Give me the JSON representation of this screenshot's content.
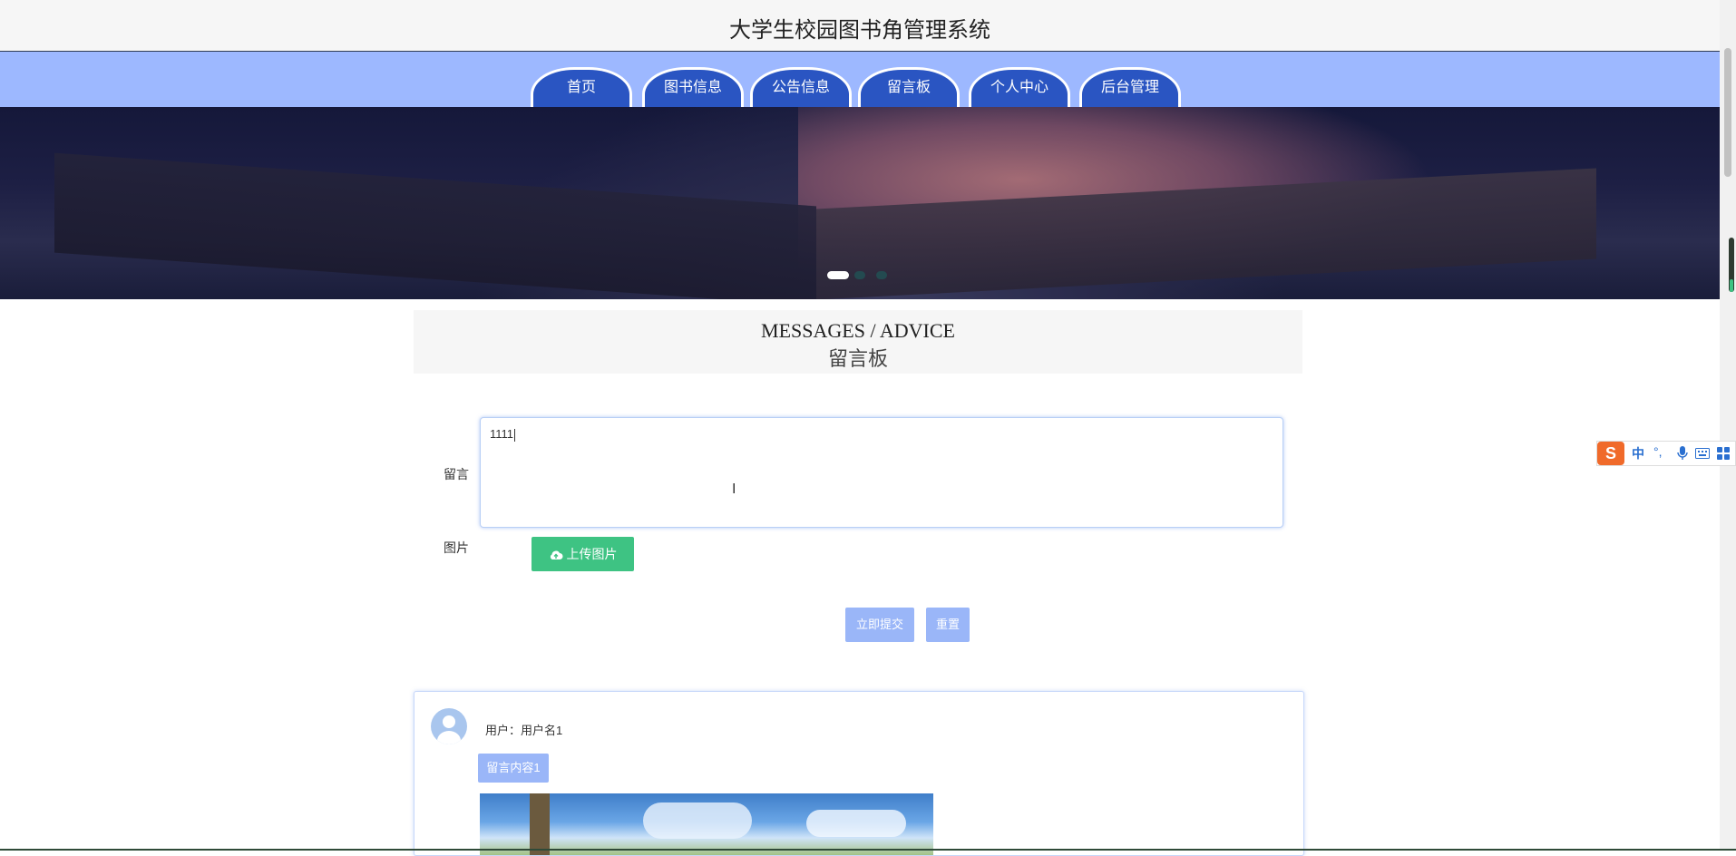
{
  "header": {
    "title": "大学生校园图书角管理系统"
  },
  "nav": {
    "tabs": [
      "首页",
      "图书信息",
      "公告信息",
      "留言板",
      "个人中心",
      "后台管理"
    ]
  },
  "section": {
    "title_en": "MESSAGES / ADVICE",
    "title_zh": "留言板"
  },
  "form": {
    "message_label": "留言",
    "message_value": "1111",
    "image_label": "图片",
    "upload_label": "上传图片",
    "submit_label": "立即提交",
    "reset_label": "重置"
  },
  "messages": [
    {
      "user": "用户：用户名1",
      "content": "留言内容1"
    }
  ],
  "ime": {
    "mode": "中",
    "punct": "°,",
    "icons": [
      "microphone-icon",
      "keyboard-icon",
      "grid-icon"
    ]
  },
  "colors": {
    "nav_bg": "#9db8ff",
    "tab_bg": "#2a55c2",
    "upload_green": "#3ec383",
    "button_blue": "#9ab6f8"
  }
}
